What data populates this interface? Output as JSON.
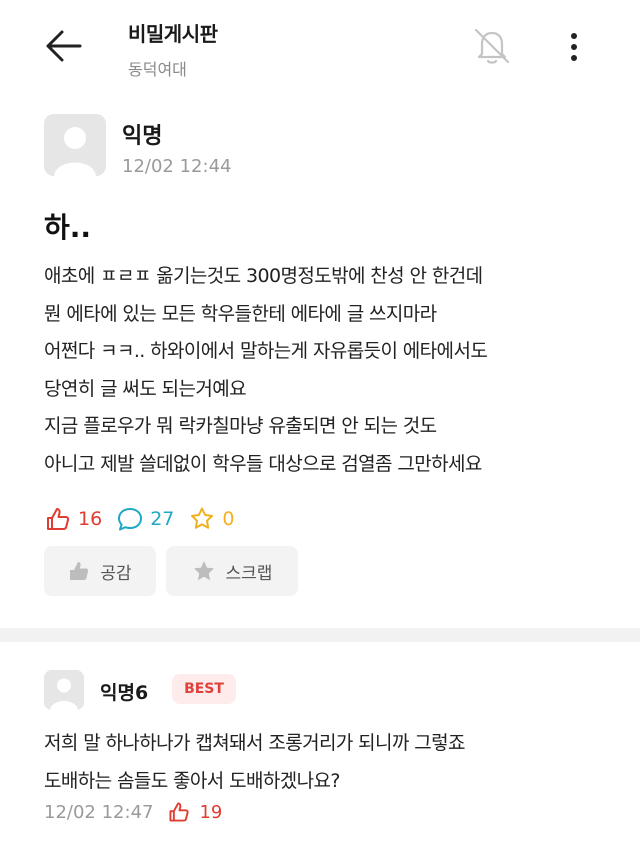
{
  "header": {
    "title": "비밀게시판",
    "subtitle": "동덕여대"
  },
  "post": {
    "author": "익명",
    "time": "12/02 12:44",
    "title": "하..",
    "body": "애초에 ㅍㄹㅍ 옮기는것도 300명정도밖에 찬성 안 한건데\n뭔 에타에 있는 모든 학우들한테 에타에 글 쓰지마라\n어쩐다 ㅋㅋ.. 하와이에서 말하는게 자유롭듯이 에타에서도\n당연히 글 써도 되는거예요\n지금 플로우가 뭐 락카칠마냥 유출되면 안 되는 것도\n아니고 제발 쓸데없이 학우들 대상으로 검열좀 그만하세요",
    "likes": "16",
    "comments": "27",
    "scraps": "0",
    "like_button_label": "공감",
    "scrap_button_label": "스크랩"
  },
  "comment": {
    "author": "익명6",
    "badge": "BEST",
    "body": "저희 말 하나하나가 캡쳐돼서 조롱거리가 되니까 그렇죠\n도배하는 솜들도 좋아서 도배하겠나요?",
    "time": "12/02 12:47",
    "likes": "19"
  },
  "colors": {
    "like": "#e03c31",
    "comment": "#1fa8c4",
    "scrap": "#f2b01e",
    "badge_bg": "#fdeceb"
  },
  "icons": [
    "back-arrow-icon",
    "bell-off-icon",
    "more-vertical-icon",
    "thumbs-up-icon",
    "speech-bubble-icon",
    "star-icon"
  ]
}
